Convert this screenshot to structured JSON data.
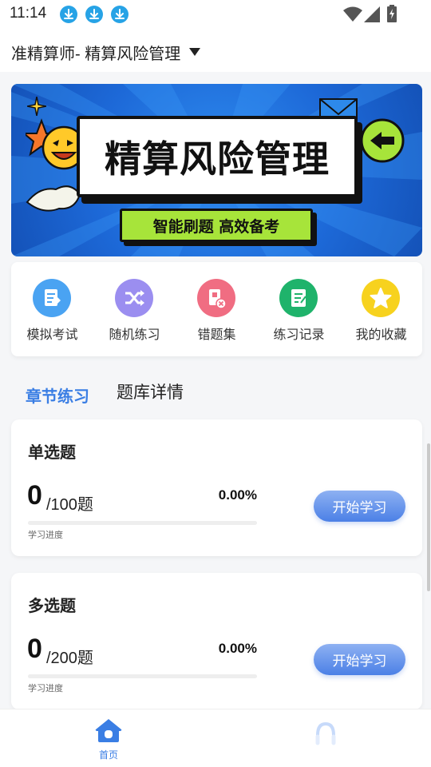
{
  "status_bar": {
    "time": "11:14",
    "icons": [
      "download-icon",
      "download-icon",
      "download-icon",
      "wifi-icon",
      "signal-icon",
      "battery-icon"
    ]
  },
  "header": {
    "title": "准精算师- 精算风险管理",
    "caret_icon": "caret-down-icon"
  },
  "banner": {
    "title": "精算风险管理",
    "slogan": "智能刷题  高效备考",
    "colors": {
      "background": "#1d69d8",
      "slogan_bg": "#a7e43a"
    }
  },
  "shortcuts": [
    {
      "label": "模拟考试",
      "icon": "exam-icon",
      "color": "#4aa3f2"
    },
    {
      "label": "随机练习",
      "icon": "shuffle-icon",
      "color": "#9b8ef0"
    },
    {
      "label": "错题集",
      "icon": "wrong-questions-icon",
      "color": "#f06d82"
    },
    {
      "label": "练习记录",
      "icon": "record-icon",
      "color": "#1fb36b"
    },
    {
      "label": "我的收藏",
      "icon": "star-icon",
      "color": "#f7d21e"
    }
  ],
  "tabs": {
    "active": "章节练习",
    "inactive": "题库详情"
  },
  "practice_cards": [
    {
      "title": "单选题",
      "done": "0",
      "total": "/100题",
      "percent": "0.00%",
      "progress": 0,
      "caption": "学习进度",
      "button": "开始学习"
    },
    {
      "title": "多选题",
      "done": "0",
      "total": "/200题",
      "percent": "0.00%",
      "progress": 0,
      "caption": "学习进度",
      "button": "开始学习"
    }
  ],
  "bottom_nav": {
    "home_label": "首页",
    "home_icon": "home-icon",
    "other_icon": "profile-icon"
  },
  "colors": {
    "accent": "#3a7ee4",
    "page_bg": "#f5f6f8"
  }
}
